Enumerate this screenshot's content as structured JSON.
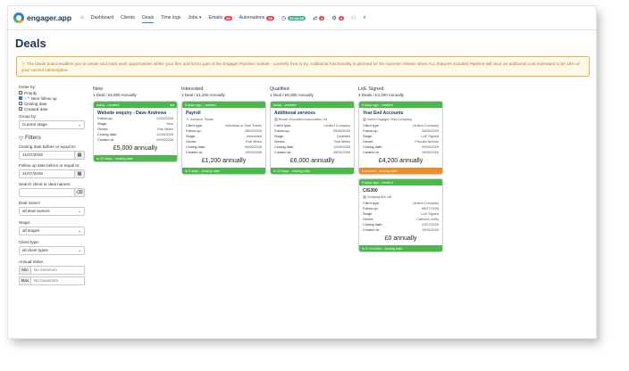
{
  "brand": {
    "name": "engager.app"
  },
  "nav": {
    "dashboard": "Dashboard",
    "clients": "Clients",
    "deals": "Deals",
    "timelogs": "Time logs",
    "jobs": "Jobs ▾",
    "emails": "Emails",
    "emails_count": "99",
    "automations": "Automations",
    "automations_count": "99",
    "timer": "00:00:00",
    "counter_a": "4",
    "counter_b": "9"
  },
  "page": {
    "title": "Deals"
  },
  "banner": {
    "text": "ⓘ The Deals board enables you to create and track work opportunities within your firm and forms part of the Engager Pipeline module - currently free to try. Additional functionality is planned for the summer release when ALL features included Pipeline will incur an additional cost estimated to be 15% of your current subscription."
  },
  "sidebar": {
    "order_by": "Order by:",
    "order_options": [
      "Priority",
      "Next follow up",
      "Closing date",
      "Created date"
    ],
    "group_by": "Group by:",
    "group_value": "Current stage",
    "filters": "Filters",
    "closing_label": "Closing date before or equal to:",
    "closing_value": "31/07/2026",
    "followup_label": "Follow up date before or equal to:",
    "followup_value": "31/07/2026",
    "search_label": "Search client or deal names:",
    "owner_label": "Deal owner:",
    "owner_value": "all deal owners",
    "stage_label": "Stage:",
    "stage_value": "all stages",
    "client_type_label": "Client type:",
    "client_type_value": "all client types",
    "annual_label": "Annual Value:",
    "min_label": "Min",
    "min_placeholder": "No minimum",
    "max_label": "Max",
    "max_placeholder": "No maximum"
  },
  "columns": [
    {
      "title": "New",
      "summary": "1 Deal / £5,000 Annually"
    },
    {
      "title": "Interested",
      "summary": "1 Deal / £1,200 Annually"
    },
    {
      "title": "Qualified",
      "summary": "1 Deal / £6,000 Annually"
    },
    {
      "title": "LoE Signed",
      "summary": "2 Deals / £4,200 Annually"
    }
  ],
  "cards": {
    "c1": {
      "top": "today - created",
      "title": "Website enquiry - Dave Andrews",
      "sub": "",
      "rows": [
        [
          "Follow-up:",
          "01/06/2026"
        ],
        [
          "Stage:",
          "New"
        ],
        [
          "Owner:",
          "Rob Millen"
        ],
        [
          "Closing date:",
          "12/06/2026"
        ],
        [
          "Created at:",
          "29/05/2026"
        ]
      ],
      "amount": "£5,000 annually",
      "bottom": "in 12 days - closing date"
    },
    "c2": {
      "top": "9 days ago - created",
      "title": "Payroll",
      "sub": "Johnson, Sarah",
      "rows": [
        [
          "Client type:",
          "Individual or Sole Trader"
        ],
        [
          "Follow-up:",
          "28/05/2026"
        ],
        [
          "Stage:",
          "Interested"
        ],
        [
          "Owner:",
          "Rob Millen"
        ],
        [
          "Closing date:",
          "05/06/2026"
        ],
        [
          "Created at:",
          "19/05/2026"
        ]
      ],
      "amount": "£1,200 annually",
      "bottom": "in 5 days - closing date"
    },
    "c3": {
      "top": "today - created",
      "title": "Additional services",
      "sub": "Reach Education Associates Ltd",
      "rows": [
        [
          "Client type:",
          "Limited Company"
        ],
        [
          "Follow-up:",
          "05/06/2026"
        ],
        [
          "Stage:",
          "Qualified"
        ],
        [
          "Owner:",
          "Rob Millen"
        ],
        [
          "Closing date:",
          "12/06/2026"
        ],
        [
          "Created at:",
          "28/05/2026"
        ]
      ],
      "amount": "£6,000 annually",
      "bottom": "in 13 days - closing date"
    },
    "c4": {
      "top": "9 days ago - created",
      "title": "Year End Accounts",
      "sub": "Client Engager Test Company",
      "rows": [
        [
          "Client type:",
          "Limited Company"
        ],
        [
          "Follow-up:",
          "28/05/2026"
        ],
        [
          "Stage:",
          "LoE Signed"
        ],
        [
          "Owner:",
          "Priscilla Nichols"
        ],
        [
          "Closing date:",
          "29/05/2026"
        ],
        [
          "Created at:",
          "19/05/2026"
        ]
      ],
      "amount": "£4,200 annually",
      "bottom": "tomorrow - closing date"
    },
    "c5": {
      "top": "9 days ago - created",
      "title": "CIS300",
      "sub": "Jumping Ant Ltd",
      "rows": [
        [
          "Client type:",
          "Limited Company"
        ],
        [
          "Follow-up:",
          "08/07/2026"
        ],
        [
          "Stage:",
          "LoE Signed"
        ],
        [
          "Owner:",
          "Catriona Iurlito"
        ],
        [
          "Closing date:",
          "31/07/2026"
        ],
        [
          "Created at:",
          "19/05/2026"
        ]
      ],
      "amount": "£0 annually",
      "bottom": "in 2+ months - closing date"
    }
  },
  "colors": {
    "accent": "#2c7fc4",
    "green": "#4bb84b",
    "orange": "#f08b2a",
    "warning": "#f0b13f"
  }
}
